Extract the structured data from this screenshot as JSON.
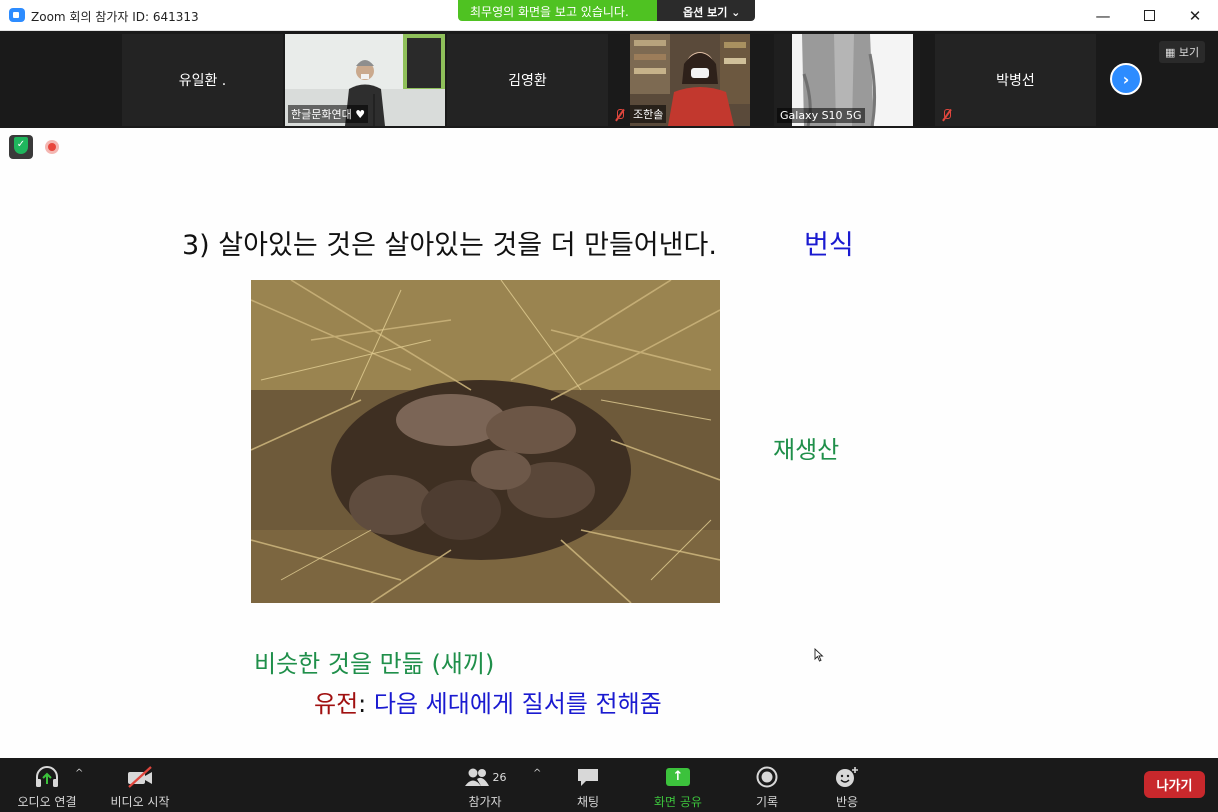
{
  "window": {
    "title": "Zoom 회의 참가자 ID: 641313",
    "minimize": "—",
    "close": "✕"
  },
  "share_banner": {
    "text": "최무영의 화면을 보고 있습니다.",
    "options_label": "옵션 보기 ⌄"
  },
  "gallery": {
    "participants": [
      {
        "name": "유일환 ."
      },
      {
        "name": "한글문화연대 ♥"
      },
      {
        "name": "김영환"
      },
      {
        "name": "조한솔"
      },
      {
        "name": "Galaxy S10 5G"
      },
      {
        "name": "박병선"
      }
    ],
    "view_label": "보기"
  },
  "slide": {
    "heading": "3) 살아있는 것은 살아있는 것을 더 만들어낸다.",
    "keyword": "번식",
    "side_label": "재생산",
    "similar_line": "비슷한 것을 만듦 (새끼)",
    "heredity_term": "유전",
    "heredity_colon": ":",
    "heredity_desc": " 다음 세대에게 질서를 전해줌"
  },
  "toolbar": {
    "audio": "오디오 연결",
    "video": "비디오 시작",
    "participants": "참가자",
    "participants_count": "26",
    "chat": "채팅",
    "share": "화면 공유",
    "record": "기록",
    "reactions": "반응",
    "leave": "나가기"
  },
  "colors": {
    "share_green": "#4fc222",
    "slide_green": "#1f8f4a",
    "slide_blue": "#1a1ad0",
    "slide_red": "#a01010",
    "leave_red": "#c8282c",
    "zoom_blue": "#2d8cff"
  }
}
